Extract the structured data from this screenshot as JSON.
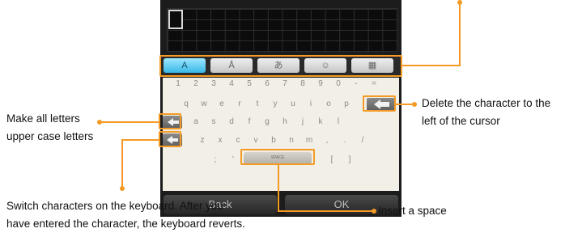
{
  "screen": {
    "tabs": [
      {
        "label": "A",
        "active": true
      },
      {
        "label": "Å",
        "active": false
      },
      {
        "label": "あ",
        "active": false
      },
      {
        "label": "☺",
        "active": false
      },
      {
        "label": "▦",
        "active": false
      }
    ],
    "keyboard": {
      "row_numbers": [
        "1",
        "2",
        "3",
        "4",
        "5",
        "6",
        "7",
        "8",
        "9",
        "0",
        "-",
        "="
      ],
      "row_q": [
        "q",
        "w",
        "e",
        "r",
        "t",
        "y",
        "u",
        "i",
        "o",
        "p"
      ],
      "row_a": [
        "a",
        "s",
        "d",
        "f",
        "g",
        "h",
        "j",
        "k",
        "l"
      ],
      "row_z": [
        "z",
        "x",
        "c",
        "v",
        "b",
        "n",
        "m",
        ",",
        ".",
        "/"
      ],
      "row_bottom_left": [
        ";",
        "'"
      ],
      "space_label": "SPACE",
      "row_bottom_right": [
        "[",
        "]"
      ]
    },
    "back_label": "Back",
    "ok_label": "OK"
  },
  "callouts": {
    "caps": [
      "Make all letters",
      "upper case letters"
    ],
    "delete": [
      "Delete the character to the",
      "left of the cursor"
    ],
    "switch": [
      "Switch characters on the keyboard. After you",
      "have entered the character, the keyboard reverts."
    ],
    "space": "Insert a space"
  },
  "colors": {
    "accent": "#f59a24",
    "active_tab": "#39b8e6"
  }
}
